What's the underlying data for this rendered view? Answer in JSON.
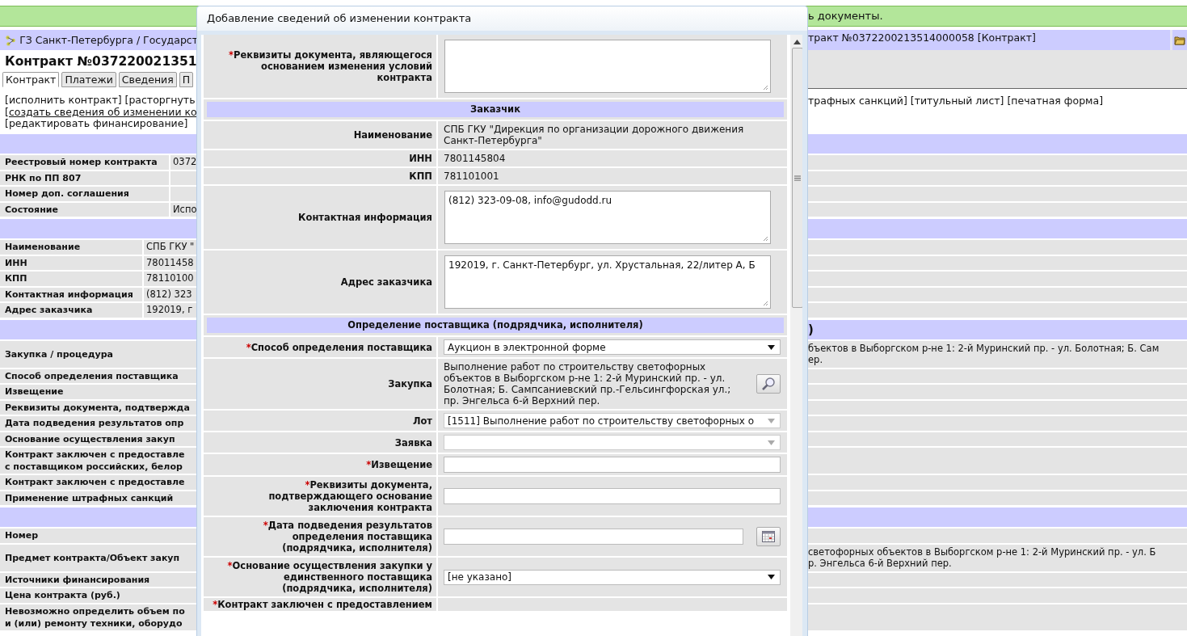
{
  "notice": {
    "text": "ь документы."
  },
  "breadcrumb": {
    "left": "ГЗ Санкт-Петербурга / Государст",
    "right": "тракт №0372200213514000058 [Контракт]"
  },
  "title": "Контракт №037220021351",
  "tabs": [
    {
      "label": "Контракт",
      "selected": true
    },
    {
      "label": "Платежи",
      "selected": false
    },
    {
      "label": "Сведения",
      "selected": false
    },
    {
      "label": "П",
      "selected": false
    }
  ],
  "actions": {
    "left": [
      {
        "kind": "text",
        "text": "[исполнить контракт] [расторгнуть"
      },
      {
        "kind": "link",
        "text": "[создать сведения об изменении ко"
      },
      {
        "kind": "text",
        "text": "[редактировать финансирование]"
      }
    ],
    "right": "трафных санкций] [титульный лист] [печатная форма]"
  },
  "blocks": [
    {
      "rows": [
        {
          "label": [
            "Реестровый номер контракта"
          ],
          "value": "0372"
        },
        {
          "label": [
            "РНК по ПП 807"
          ]
        },
        {
          "label": [
            "Номер доп. соглашения"
          ]
        },
        {
          "label": [
            "Состояние"
          ],
          "value": "Испо"
        }
      ]
    },
    {
      "rows": [
        {
          "label": [
            "Наименование"
          ],
          "value": "СПБ ГКУ \""
        },
        {
          "label": [
            "ИНН"
          ],
          "value": "78011458"
        },
        {
          "label": [
            "КПП"
          ],
          "value": "78110100"
        },
        {
          "label": [
            "Контактная информация"
          ],
          "value": "(812) 323"
        },
        {
          "label": [
            "Адрес заказчика"
          ],
          "value": "192019, г"
        }
      ]
    },
    {
      "header_right": ")",
      "rows": [
        {
          "label": [
            "Закупка / процедура"
          ],
          "right": [
            "бъектов в Выборгском р-не 1: 2-й Муринский пр. - ул. Болотная; Б. Сам",
            "ер."
          ]
        },
        {
          "label": [
            "Способ определения поставщика"
          ]
        },
        {
          "label": [
            "Извещение"
          ]
        },
        {
          "label": [
            "Реквизиты документа, подтвержда"
          ]
        },
        {
          "label": [
            "Дата подведения результатов опр"
          ]
        },
        {
          "label": [
            "Основание осуществления закуп"
          ]
        },
        {
          "label": [
            "Контракт заключен с предоставле",
            "с поставщиком российских, белор"
          ]
        },
        {
          "label": [
            "Контракт заключен с предоставле"
          ]
        },
        {
          "label": [
            "Применение штрафных санкций"
          ]
        }
      ]
    },
    {
      "rows": [
        {
          "label": [
            "Номер"
          ]
        },
        {
          "label": [
            "Предмет контракта/Объект закуп"
          ],
          "right": [
            "светофорных объектов в Выборгском р-не 1: 2-й Муринский пр. - ул. Б",
            "р. Энгельса 6-й Верхний пер."
          ]
        },
        {
          "label": [
            "Источники финансирования"
          ]
        },
        {
          "label": [
            "Цена контракта (руб.)"
          ]
        },
        {
          "label": [
            "Невозможно определить объем по",
            "и (или) ремонту техники, оборудо"
          ]
        }
      ]
    }
  ],
  "dialog": {
    "title": "Добавление сведений об изменении контракта",
    "required_mark": "*",
    "rows": [
      {
        "kind": "textarea",
        "required": true,
        "label": "Реквизиты документа, являющегося основанием изменения условий контракта"
      },
      {
        "kind": "section",
        "label": "Заказчик"
      },
      {
        "kind": "text",
        "required": false,
        "label": "Наименование",
        "value": "СПБ ГКУ \"Дирекция по организации дорожного движения Санкт-Петербурга\""
      },
      {
        "kind": "text",
        "required": false,
        "label": "ИНН",
        "value": "7801145804"
      },
      {
        "kind": "text",
        "required": false,
        "label": "КПП",
        "value": "781101001"
      },
      {
        "kind": "textarea",
        "required": false,
        "label": "Контактная информация",
        "value": "(812) 323-09-08, info@gudodd.ru"
      },
      {
        "kind": "textarea",
        "required": false,
        "label": "Адрес заказчика",
        "value": "192019, г. Санкт-Петербург, ул. Хрустальная, 22/литер А, Б"
      },
      {
        "kind": "section",
        "label": "Определение поставщика (подрядчика, исполнителя)"
      },
      {
        "kind": "select",
        "required": true,
        "disabled": false,
        "label": "Способ определения поставщика",
        "value": "Аукцион в электронной форме"
      },
      {
        "kind": "lookup",
        "required": false,
        "label": "Закупка",
        "value": "Выполнение работ по строительству светофорных объектов в Выборгском р-не 1: 2-й Муринский пр. - ул. Болотная; Б. Сампсаниевский пр.-Гельсингфорская ул.; пр. Энгельса 6-й Верхний пер."
      },
      {
        "kind": "select",
        "required": false,
        "disabled": true,
        "label": "Лот",
        "value": "[1511] Выполнение работ по строительству светофорных о"
      },
      {
        "kind": "select",
        "required": false,
        "disabled": true,
        "label": "Заявка"
      },
      {
        "kind": "input",
        "required": true,
        "label": "Извещение"
      },
      {
        "kind": "input",
        "required": true,
        "label": "Реквизиты документа, подтверждающего основание заключения контракта"
      },
      {
        "kind": "date",
        "required": true,
        "label": "Дата подведения результатов определения поставщика (подрядчика, исполнителя)"
      },
      {
        "kind": "select",
        "required": true,
        "disabled": false,
        "label": "Основание осуществления закупки у единственного поставщика (подрядчика, исполнителя)",
        "value": "[не указано]"
      },
      {
        "kind": "partial",
        "required": true,
        "label": "Контракт заключен с предоставлением"
      }
    ]
  }
}
